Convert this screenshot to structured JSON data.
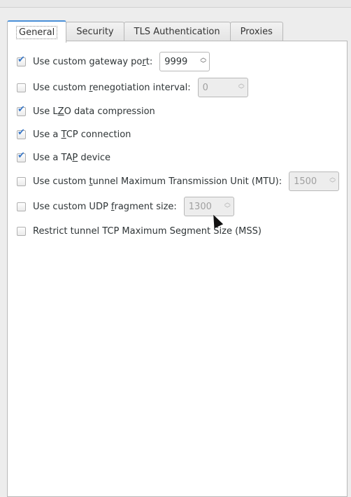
{
  "tabs": [
    "General",
    "Security",
    "TLS Authentication",
    "Proxies"
  ],
  "options": [
    {
      "pre": "Use custom gateway po",
      "key": "r",
      "post": "t:",
      "checked": true,
      "spin": "9999",
      "enabled": true
    },
    {
      "pre": "Use custom ",
      "key": "r",
      "post": "enegotiation interval:",
      "checked": false,
      "spin": "0",
      "enabled": false
    },
    {
      "pre": "Use L",
      "key": "Z",
      "post": "O data compression",
      "checked": true
    },
    {
      "pre": "Use a ",
      "key": "T",
      "post": "CP connection",
      "checked": true
    },
    {
      "pre": "Use a TA",
      "key": "P",
      "post": " device",
      "checked": true
    },
    {
      "pre": "Use custom ",
      "key": "t",
      "post": "unnel Maximum Transmission Unit (MTU):",
      "checked": false,
      "spin": "1500",
      "enabled": false
    },
    {
      "pre": "Use custom UDP ",
      "key": "f",
      "post": "ragment size:",
      "checked": false,
      "spin": "1300",
      "enabled": false
    },
    {
      "pre": "Restrict tunnel TCP Maximum Segment Size (MSS)",
      "key": "",
      "post": "",
      "checked": false
    }
  ]
}
